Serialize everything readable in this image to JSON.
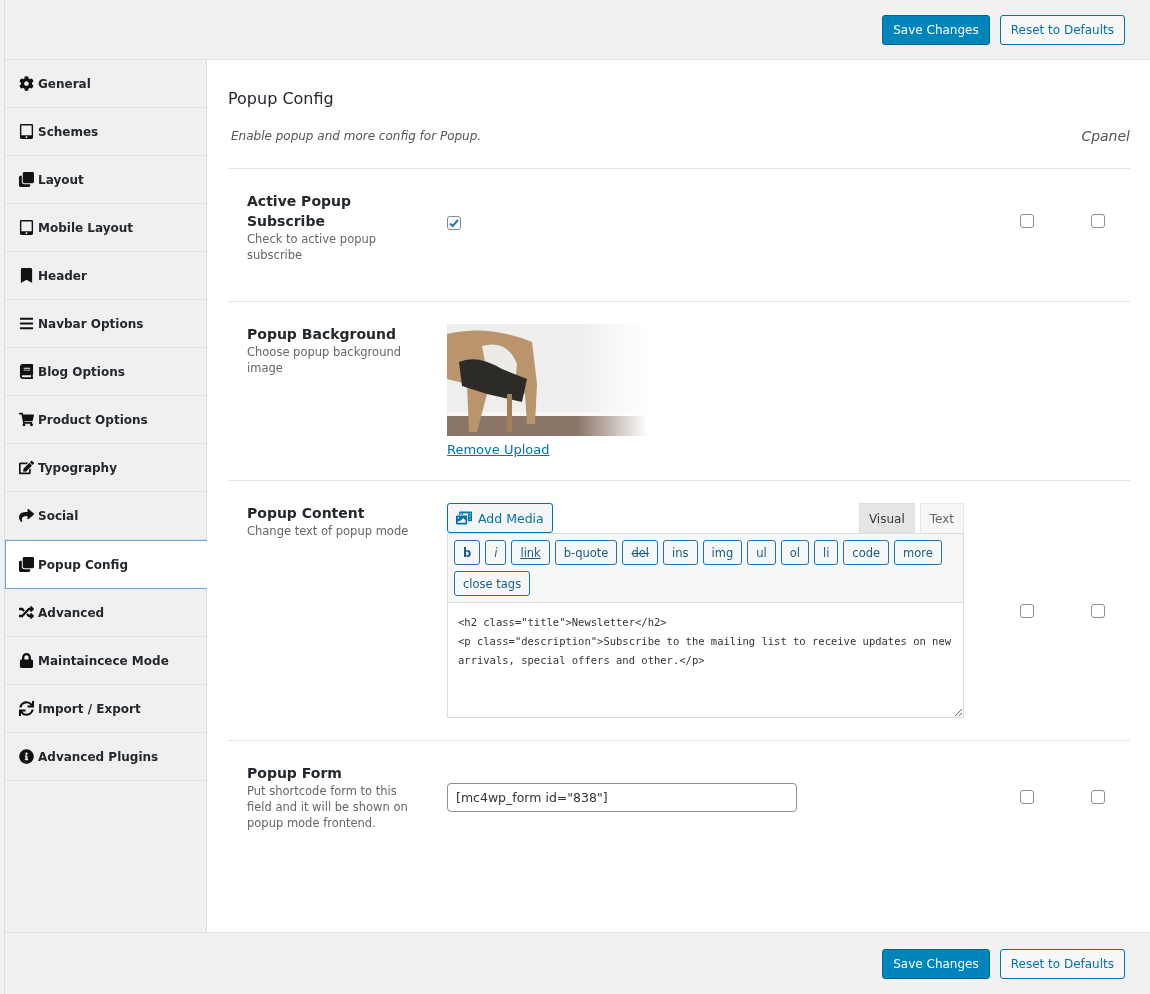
{
  "top_buttons": [
    {
      "label": "Save Changes",
      "kind": "primary"
    },
    {
      "label": "Reset to Defaults",
      "kind": "secondary"
    }
  ],
  "sidebar": {
    "items": [
      {
        "label": "General",
        "selected": false
      },
      {
        "label": "Schemes",
        "selected": false
      },
      {
        "label": "Layout",
        "selected": false
      },
      {
        "label": "Mobile Layout",
        "selected": false
      },
      {
        "label": "Header",
        "selected": false
      },
      {
        "label": "Navbar Options",
        "selected": false
      },
      {
        "label": "Blog Options",
        "selected": false
      },
      {
        "label": "Product Options",
        "selected": false
      },
      {
        "label": "Typography",
        "selected": false
      },
      {
        "label": "Social",
        "selected": false
      },
      {
        "label": "Popup Config",
        "selected": true
      },
      {
        "label": "Advanced",
        "selected": false
      },
      {
        "label": "Maintaincece Mode",
        "selected": false
      },
      {
        "label": "Import / Export",
        "selected": false
      },
      {
        "label": "Advanced Plugins",
        "selected": false
      }
    ]
  },
  "section": {
    "title": "Popup Config",
    "description": "Enable popup and more config for Popup.",
    "tag": "Cpanel"
  },
  "fields": [
    {
      "kind": "checkbox",
      "title": "Active Popup Subscribe",
      "description": "Check to active popup subscribe",
      "checked": true,
      "extra_checks": [
        false,
        false
      ]
    },
    {
      "title": "Popup Background",
      "description": "Choose popup background image",
      "link": "Remove Upload"
    },
    {
      "kind": "editor",
      "title": "Popup Content",
      "description": "Change text of popup mode",
      "add_media": "Add Media",
      "tabs": [
        {
          "label": "Visual",
          "selected": true
        },
        {
          "label": "Text",
          "selected": false
        }
      ],
      "quicktags": [
        {
          "label": "b",
          "kind": "bold"
        },
        {
          "label": "i",
          "kind": "italic"
        },
        {
          "label": "link",
          "kind": "underline"
        },
        {
          "label": "b-quote",
          "kind": "plain"
        },
        {
          "label": "del",
          "kind": "strike"
        },
        {
          "label": "ins",
          "kind": "plain"
        },
        {
          "label": "img",
          "kind": "plain"
        },
        {
          "label": "ul",
          "kind": "plain"
        },
        {
          "label": "ol",
          "kind": "plain"
        },
        {
          "label": "li",
          "kind": "plain"
        },
        {
          "label": "code",
          "kind": "plain"
        },
        {
          "label": "more",
          "kind": "plain"
        },
        {
          "label": "close tags",
          "kind": "plain"
        }
      ],
      "value": "<h2 class=\"title\">Newsletter</h2>\n<p class=\"description\">Subscribe to the mailing list to receive updates on new arrivals, special offers and other.</p>",
      "extra_checks": [
        false,
        false
      ]
    },
    {
      "kind": "text",
      "title": "Popup Form",
      "description": "Put shortcode form to this field and it will be shown on popup mode frontend.",
      "value": "[mc4wp_form id=\"838\"]",
      "extra_checks": [
        false,
        false
      ]
    }
  ],
  "bottom_buttons": [
    {
      "label": "Save Changes",
      "kind": "primary"
    },
    {
      "label": "Reset to Defaults",
      "kind": "secondary"
    }
  ]
}
